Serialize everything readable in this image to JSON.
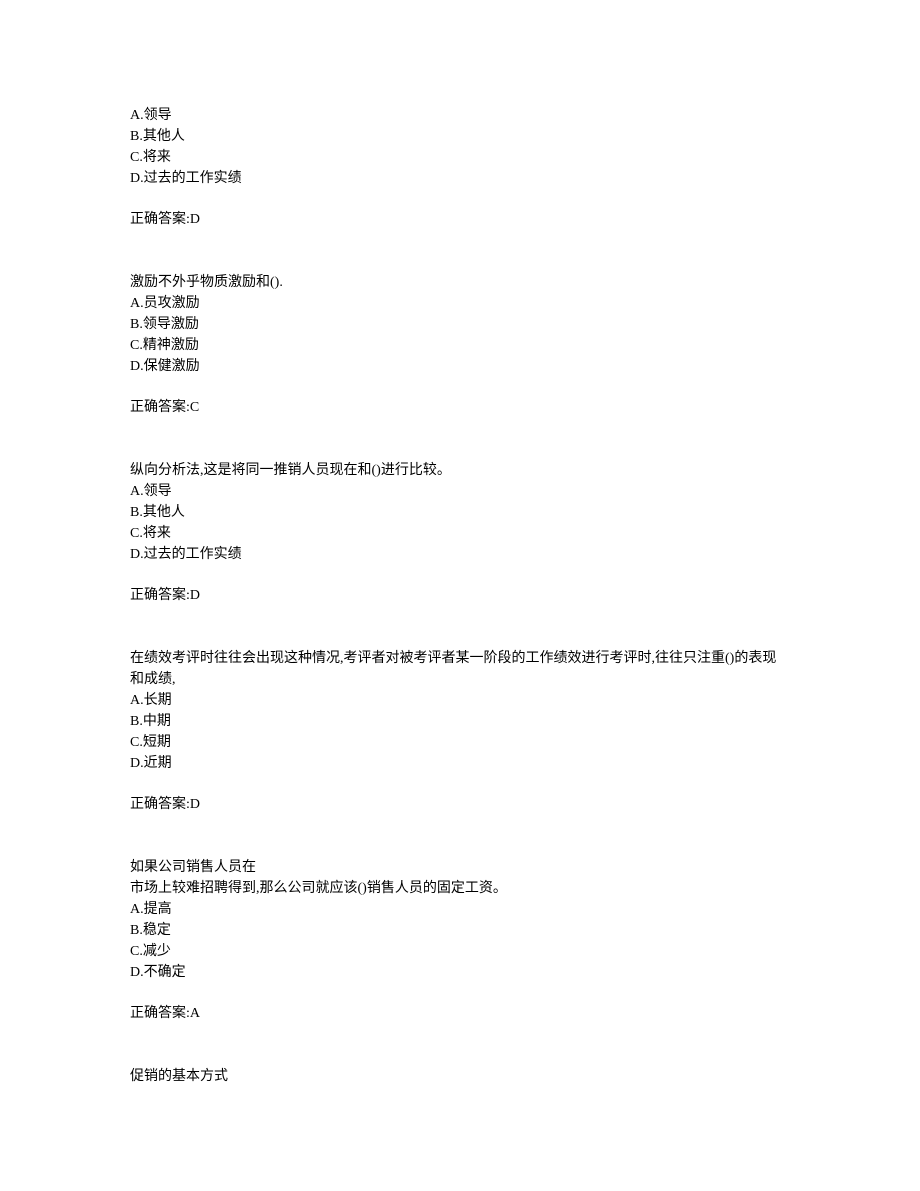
{
  "questions": [
    {
      "stem": "",
      "options": [
        "A.领导",
        "B.其他人",
        "C.将来",
        "D.过去的工作实绩"
      ],
      "answer": "正确答案:D"
    },
    {
      "stem": "激励不外乎物质激励和().",
      "options": [
        "A.员攻激励",
        "B.领导激励",
        "C.精神激励",
        "D.保健激励"
      ],
      "answer": "正确答案:C"
    },
    {
      "stem": "纵向分析法,这是将同一推销人员现在和()进行比较。",
      "options": [
        "A.领导",
        "B.其他人",
        "C.将来",
        "D.过去的工作实绩"
      ],
      "answer": "正确答案:D"
    },
    {
      "stem": "在绩效考评时往往会出现这种情况,考评者对被考评者某一阶段的工作绩效进行考评时,往往只注重()的表现和成绩,",
      "options": [
        "A.长期",
        "B.中期",
        "C.短期",
        "D.近期"
      ],
      "answer": "正确答案:D"
    },
    {
      "stem": "如果公司销售人员在\n市场上较难招聘得到,那么公司就应该()销售人员的固定工资。",
      "options": [
        "A.提高",
        "B.稳定",
        "C.减少",
        "D.不确定"
      ],
      "answer": "正确答案:A"
    },
    {
      "stem": "促销的基本方式",
      "options": [],
      "answer": ""
    }
  ]
}
